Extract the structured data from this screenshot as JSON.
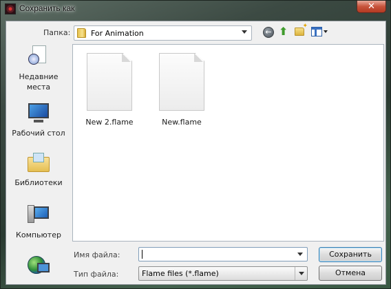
{
  "window": {
    "title": "Сохранить как",
    "close_glyph": "✕"
  },
  "toolbar": {
    "lookin_label": "Папка:",
    "current_folder": "For Animation",
    "back_glyph": "←",
    "up_glyph": "⬆"
  },
  "places": [
    {
      "label_line1": "Недавние",
      "label_line2": "места",
      "icon": "recent-places-icon"
    },
    {
      "label_line1": "Рабочий стол",
      "label_line2": "",
      "icon": "desktop-icon"
    },
    {
      "label_line1": "Библиотеки",
      "label_line2": "",
      "icon": "libraries-icon"
    },
    {
      "label_line1": "Компьютер",
      "label_line2": "",
      "icon": "computer-icon"
    },
    {
      "label_line1": "",
      "label_line2": "",
      "icon": "network-icon"
    }
  ],
  "files": [
    {
      "name": "New 2.flame",
      "icon": "document-icon"
    },
    {
      "name": "New.flame",
      "icon": "document-icon"
    }
  ],
  "form": {
    "filename_label": "Имя файла:",
    "filename_value": "",
    "filetype_label": "Тип файла:",
    "filetype_value": "Flame files (*.flame)"
  },
  "buttons": {
    "save": "Сохранить",
    "cancel": "Отмена"
  }
}
